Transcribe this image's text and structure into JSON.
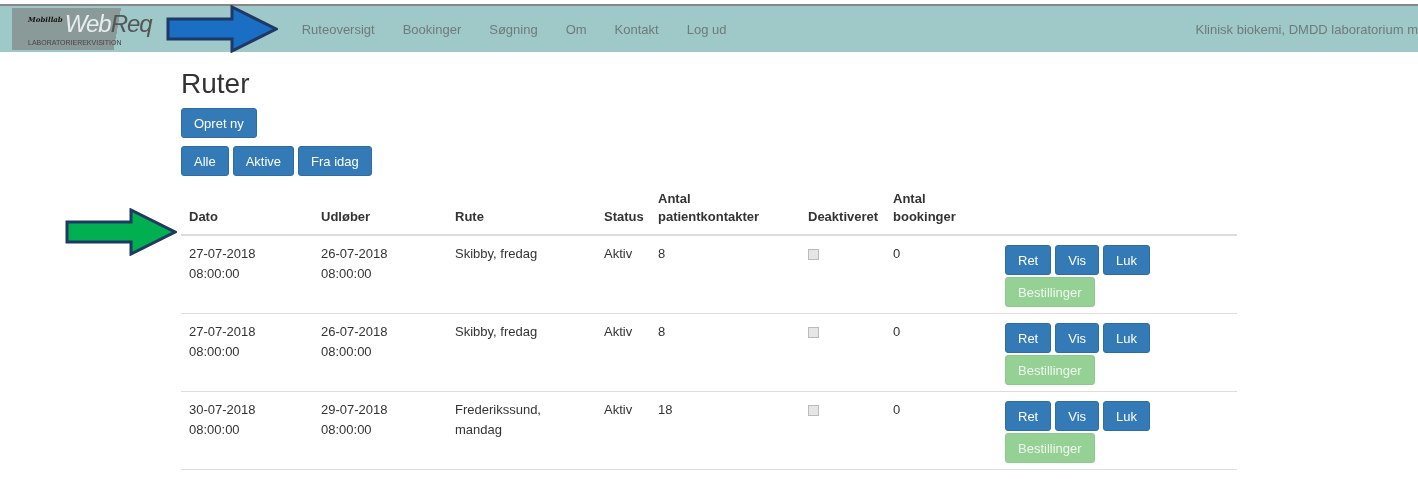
{
  "brand": {
    "tagline": "Mobillab",
    "name_light": "Web",
    "name_dark": "Req",
    "subtitle": "LABORATORIEREKVISITION"
  },
  "nav": {
    "items": [
      "Ruteoversigt",
      "Bookinger",
      "Søgning",
      "Om",
      "Kontakt",
      "Log ud"
    ],
    "user": "Klinisk biokemi, DMDD laboratorium m"
  },
  "page": {
    "title": "Ruter",
    "create_button": "Opret ny",
    "filters": [
      "Alle",
      "Aktive",
      "Fra idag"
    ]
  },
  "table": {
    "columns": [
      "Dato",
      "Udløber",
      "Rute",
      "Status",
      "Antal patientkontakter",
      "Deaktiveret",
      "Antal bookinger"
    ],
    "rows": [
      {
        "date": "27-07-2018 08:00:00",
        "expires": "26-07-2018 08:00:00",
        "route": "Skibby, fredag",
        "status": "Aktiv",
        "contacts": "8",
        "deactivated": {
          "checked": false,
          "disabled": true
        },
        "bookings": "0",
        "actions": [
          {
            "label": "Ret",
            "kind": "primary",
            "disabled": false
          },
          {
            "label": "Vis",
            "kind": "primary",
            "disabled": false
          },
          {
            "label": "Luk",
            "kind": "primary",
            "disabled": false
          },
          {
            "label": "Bestillinger",
            "kind": "success",
            "disabled": true
          }
        ]
      },
      {
        "date": "27-07-2018 08:00:00",
        "expires": "26-07-2018 08:00:00",
        "route": "Skibby, fredag",
        "status": "Aktiv",
        "contacts": "8",
        "deactivated": {
          "checked": false,
          "disabled": true
        },
        "bookings": "0",
        "actions": [
          {
            "label": "Ret",
            "kind": "primary",
            "disabled": false
          },
          {
            "label": "Vis",
            "kind": "primary",
            "disabled": false
          },
          {
            "label": "Luk",
            "kind": "primary",
            "disabled": false
          },
          {
            "label": "Bestillinger",
            "kind": "success",
            "disabled": true
          }
        ]
      },
      {
        "date": "30-07-2018 08:00:00",
        "expires": "29-07-2018 08:00:00",
        "route": "Frederikssund, mandag",
        "status": "Aktiv",
        "contacts": "18",
        "deactivated": {
          "checked": false,
          "disabled": true
        },
        "bookings": "0",
        "actions": [
          {
            "label": "Ret",
            "kind": "primary",
            "disabled": false
          },
          {
            "label": "Vis",
            "kind": "primary",
            "disabled": false
          },
          {
            "label": "Luk",
            "kind": "primary",
            "disabled": false
          },
          {
            "label": "Bestillinger",
            "kind": "success",
            "disabled": true
          }
        ]
      }
    ]
  }
}
